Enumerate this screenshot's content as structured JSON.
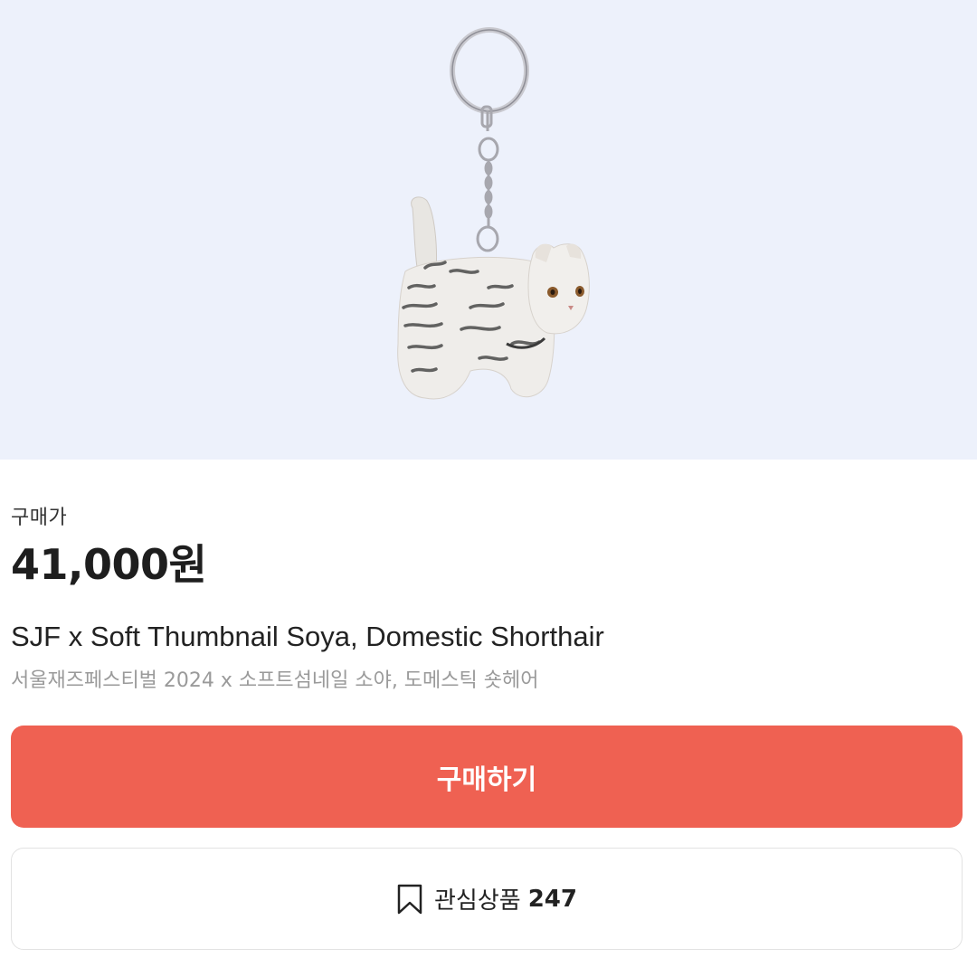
{
  "product": {
    "image_alt": "product-image",
    "price_label": "구매가",
    "price": "41,000원",
    "title_en": "SJF x Soft Thumbnail Soya, Domestic Shorthair",
    "title_ko": "서울재즈페스티벌 2024 x 소프트섬네일 소야, 도메스틱 숏헤어"
  },
  "actions": {
    "buy_label": "구매하기",
    "wishlist_label": "관심상품",
    "wishlist_count": "247"
  },
  "colors": {
    "hero_background": "#edf1fb",
    "buy_button": "#ef6152",
    "wishlist_border": "#e2e2e2"
  },
  "icons": {
    "wishlist": "bookmark-icon"
  }
}
